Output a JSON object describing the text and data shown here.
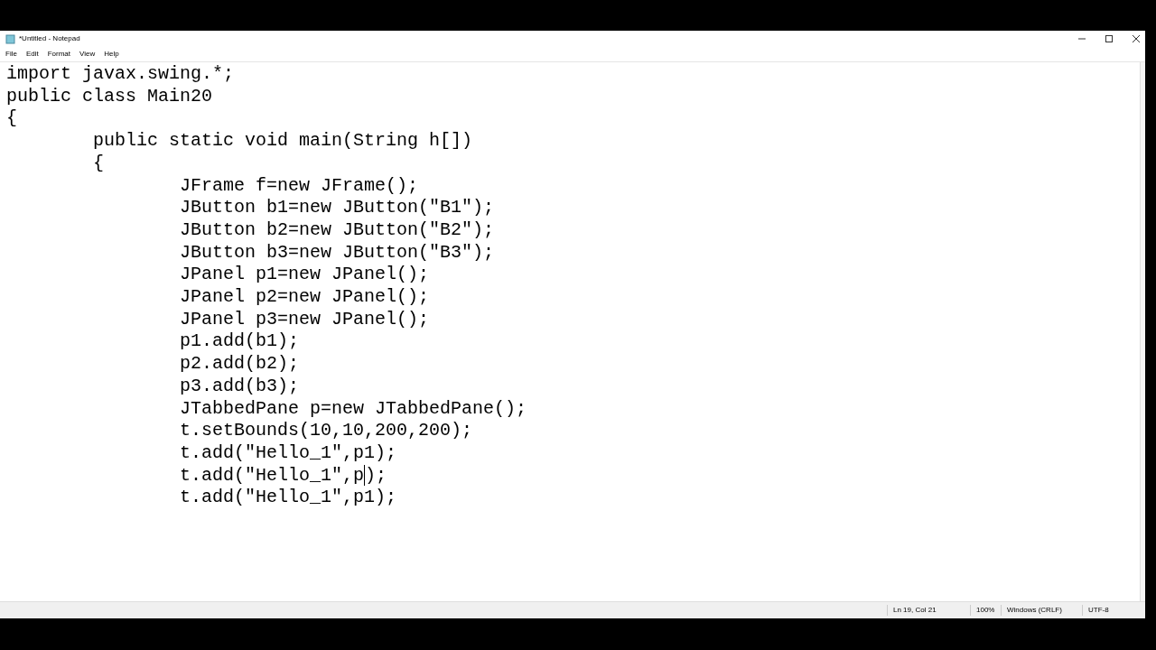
{
  "window": {
    "title": "*Untitled - Notepad"
  },
  "menu": [
    "File",
    "Edit",
    "Format",
    "View",
    "Help"
  ],
  "editor": {
    "lines": [
      {
        "text": "import javax.swing.*;"
      },
      {
        "text": "public class Main20"
      },
      {
        "text": "{"
      },
      {
        "text": "\tpublic static void main(String h[])"
      },
      {
        "text": "\t{"
      },
      {
        "text": "\t\tJFrame f=new JFrame();"
      },
      {
        "text": "\t\tJButton b1=new JButton(\"B1\");"
      },
      {
        "text": "\t\tJButton b2=new JButton(\"B2\");"
      },
      {
        "text": "\t\tJButton b3=new JButton(\"B3\");"
      },
      {
        "text": "\t\tJPanel p1=new JPanel();"
      },
      {
        "text": "\t\tJPanel p2=new JPanel();"
      },
      {
        "text": "\t\tJPanel p3=new JPanel();"
      },
      {
        "text": "\t\tp1.add(b1);"
      },
      {
        "text": "\t\tp2.add(b2);"
      },
      {
        "text": "\t\tp3.add(b3);"
      },
      {
        "text": "\t\tJTabbedPane p=new JTabbedPane();"
      },
      {
        "text": "\t\tt.setBounds(10,10,200,200);"
      },
      {
        "text": "\t\tt.add(\"Hello_1\",p1);"
      },
      {
        "text": "\t\tt.add(\"Hello_1\",p",
        "after_caret": ");"
      },
      {
        "text": "\t\tt.add(\"Hello_1\",p1);"
      }
    ]
  },
  "status_bar": [
    "Ln 19, Col 21",
    "100%",
    "Windows (CRLF)",
    "UTF-8"
  ]
}
